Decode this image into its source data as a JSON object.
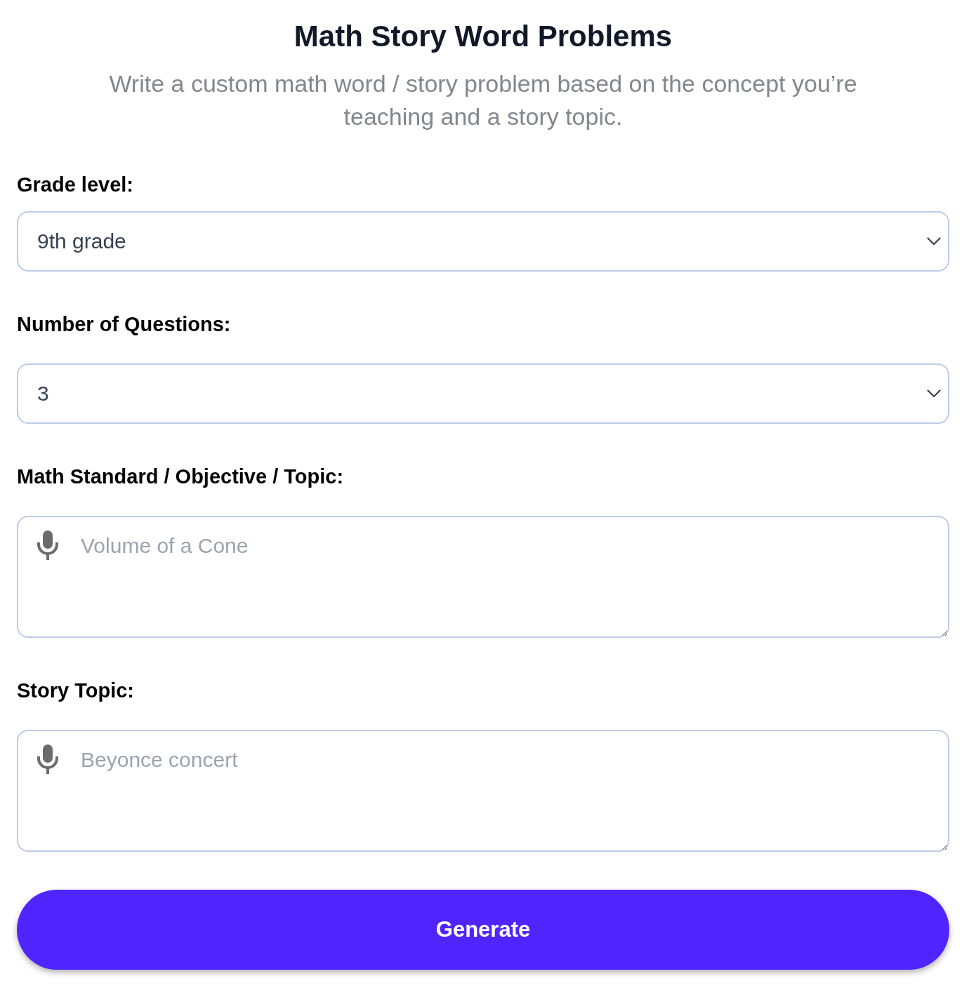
{
  "title": "Math Story Word Problems",
  "subtitle": "Write a custom math word / story problem based on the concept you’re teaching and a story topic.",
  "fields": [
    {
      "kind": "select",
      "label": "Grade level:",
      "value": "9th grade"
    },
    {
      "kind": "select",
      "label": "Number of Questions:",
      "value": "3"
    },
    {
      "kind": "textarea",
      "label": "Math Standard / Objective / Topic:",
      "placeholder": "Volume of a Cone"
    },
    {
      "kind": "textarea",
      "label": "Story Topic:",
      "placeholder": "Beyonce concert"
    }
  ],
  "submit_button": {
    "label": "Generate"
  }
}
